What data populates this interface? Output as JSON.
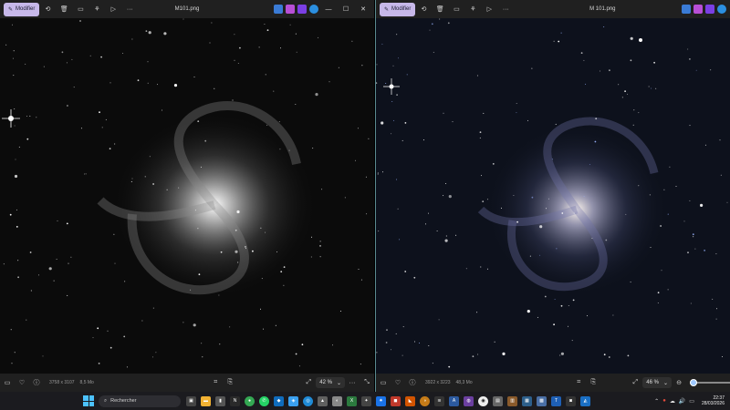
{
  "windows": [
    {
      "title": "M101.png",
      "edit_label": "Modifier",
      "dimensions": "3758 x 3107",
      "file_size": "8,5 Mo",
      "zoom": "42 %",
      "palette": "grayscale"
    },
    {
      "title": "M 101.png",
      "edit_label": "Modifier",
      "dimensions": "3922 x 3223",
      "file_size": "48,3 Mo",
      "zoom": "46 %",
      "palette": "color",
      "zoom_slider_level": 0.1
    }
  ],
  "taskbar": {
    "search_placeholder": "Rechercher",
    "time": "22:37",
    "date": "28/03/2026"
  },
  "icons": {
    "edit": "edit-pencil-icon",
    "rotate": "rotate-icon",
    "delete": "trash-icon",
    "edit_tool": "edit-tool-icon",
    "filters": "filters-icon",
    "slideshow": "slideshow-icon",
    "more": "more-icon",
    "minimize": "minimize-icon",
    "maximize": "maximize-icon",
    "close": "close-icon"
  },
  "colors": {
    "accent": "#c7b8ea",
    "taskbar": "#1b1b1f",
    "divider": "#5a8a8f"
  }
}
